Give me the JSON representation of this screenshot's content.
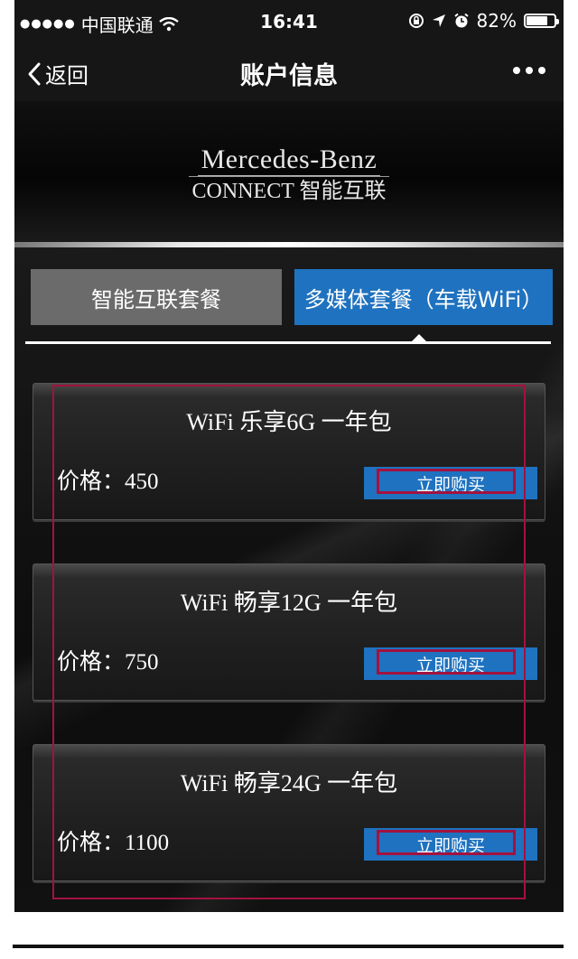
{
  "status_bar": {
    "carrier": "中国联通",
    "time": "16:41",
    "battery": "82%",
    "battery_level": 0.82
  },
  "nav": {
    "back_label": "返回",
    "title": "账户信息"
  },
  "brand": {
    "name": "Mercedes-Benz",
    "sub": "CONNECT 智能互联"
  },
  "tabs": [
    {
      "label": "智能互联套餐",
      "selected": false
    },
    {
      "label": "多媒体套餐（车载WiFi）",
      "selected": true
    }
  ],
  "packages": [
    {
      "name": "WiFi 乐享6G 一年包",
      "price": "价格：450",
      "buy_label": "立即购买"
    },
    {
      "name": "WiFi 畅享12G 一年包",
      "price": "价格：750",
      "buy_label": "立即购买"
    },
    {
      "name": "WiFi 畅享24G 一年包",
      "price": "价格：1100",
      "buy_label": "立即购买"
    }
  ],
  "colors": {
    "accent": "#1f72bf",
    "tab_inactive": "#6b6b6b",
    "highlight": "#a3123f",
    "background": "#000000"
  }
}
